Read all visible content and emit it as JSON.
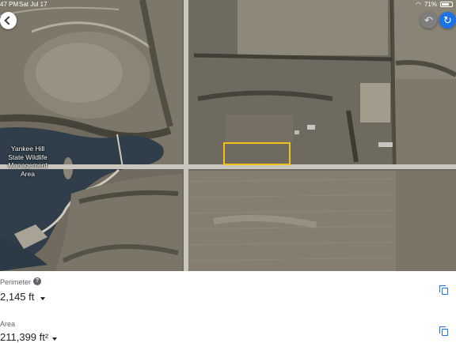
{
  "status_bar": {
    "time": "47 PM",
    "date": "Sat Jul 17",
    "battery": "71%",
    "battery_level": 0.71
  },
  "map": {
    "label_lines": [
      "Yankee Hill",
      "State Wildlife",
      "Management",
      "Area"
    ],
    "buttons": {
      "back_icon": "back-chevron-icon",
      "undo_icon": "undo-icon",
      "redo_icon": "redo-icon",
      "undo_glyph": "↶",
      "redo_glyph": "↻"
    },
    "colors": {
      "water": "#2f3e4a",
      "road": "#c9c6bd",
      "measure_outline": "#f2c21b"
    }
  },
  "measurement": {
    "perimeter": {
      "label": "Perimeter",
      "value": "2,145 ft",
      "help_glyph": "?"
    },
    "area": {
      "label": "Area",
      "value": "211,399 ft²"
    }
  },
  "colors": {
    "accent": "#1a73e8",
    "text_primary": "#202124",
    "text_secondary": "#5f6368"
  }
}
